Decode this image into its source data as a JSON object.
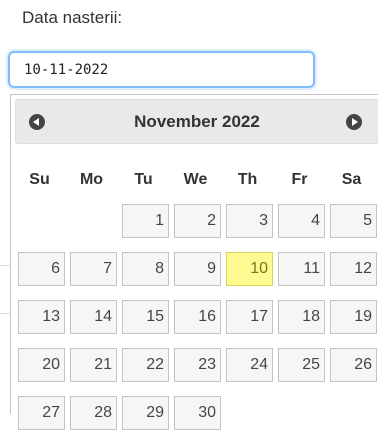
{
  "form": {
    "label": "Data nasterii:",
    "date_value": "10-11-2022"
  },
  "datepicker": {
    "title": "November 2022",
    "prev_icon": "chevron-left-circle-icon",
    "next_icon": "chevron-right-circle-icon",
    "weekdays": [
      "Su",
      "Mo",
      "Tu",
      "We",
      "Th",
      "Fr",
      "Sa"
    ],
    "first_weekday_index": 2,
    "days_in_month": 30,
    "highlighted_day": 10,
    "colors": {
      "header_bg": "#e9e9e9",
      "day_bg": "#f6f6f6",
      "highlight_bg": "#fffa90",
      "highlight_border": "#dad55e",
      "input_focus_border": "#80bdff"
    }
  }
}
